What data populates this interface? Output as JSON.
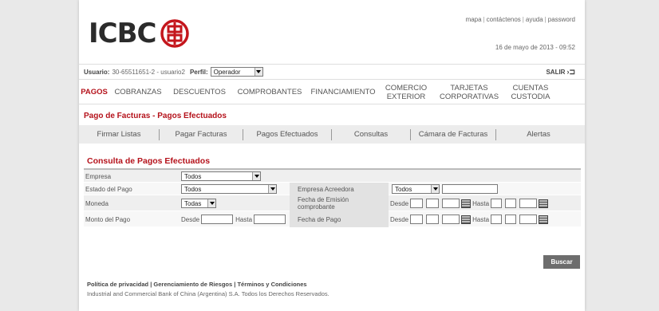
{
  "header": {
    "logo_text": "ICBC",
    "top_links": [
      "mapa",
      "contáctenos",
      "ayuda",
      "password"
    ],
    "datetime": "16 de mayo de 2013 - 09:52"
  },
  "userbar": {
    "usuario_label": "Usuario:",
    "usuario_value": "30-65511651-2 - usuario2",
    "perfil_label": "Perfil:",
    "perfil_value": "Operador",
    "salir_label": "SALIR"
  },
  "nav": {
    "items": [
      {
        "label": "PAGOS"
      },
      {
        "label": "COBRANZAS"
      },
      {
        "label": "DESCUENTOS"
      },
      {
        "label": "COMPROBANTES"
      },
      {
        "label": "FINANCIAMIENTO"
      },
      {
        "label": "COMERCIO\nEXTERIOR"
      },
      {
        "label": "TARJETAS\nCORPORATIVAS"
      },
      {
        "label": "CUENTAS\nCUSTODIA"
      }
    ]
  },
  "section_title": "Pago de Facturas - Pagos Efectuados",
  "subnav": {
    "tabs": [
      "Firmar Listas",
      "Pagar Facturas",
      "Pagos Efectuados",
      "Consultas",
      "Cámara de Facturas",
      "Alertas"
    ]
  },
  "panel_title": "Consulta de Pagos Efectuados",
  "form": {
    "empresa_label": "Empresa",
    "empresa_value": "Todos",
    "estado_label": "Estado del Pago",
    "estado_value": "Todos",
    "acreedora_label": "Empresa Acreedora",
    "acreedora_value": "Todos",
    "moneda_label": "Moneda",
    "moneda_value": "Todas",
    "fecha_emision_label": "Fecha de Emisión comprobante",
    "monto_label": "Monto del Pago",
    "fecha_pago_label": "Fecha de Pago",
    "desde_label": "Desde",
    "hasta_label": "Hasta"
  },
  "buscar_label": "Buscar",
  "footer": {
    "links": [
      "Política de privacidad",
      "Gerenciamiento de Riesgos",
      "Términos y Condiciones"
    ],
    "copyright": "Industrial and Commercial Bank of China (Argentina) S.A. Todos los Derechos Reservados."
  },
  "colors": {
    "brand_red": "#b5121b",
    "button_grey": "#6d6d6d"
  }
}
